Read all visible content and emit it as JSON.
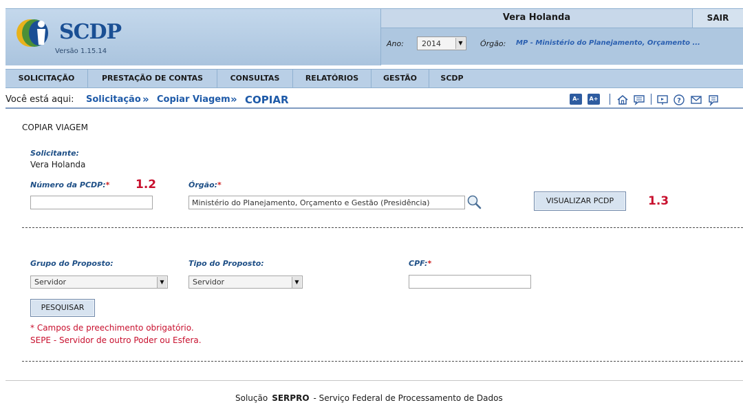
{
  "header": {
    "app_name": "SCDP",
    "version": "Versão 1.15.14",
    "user_name": "Vera Holanda",
    "logout_label": "SAIR",
    "year_label": "Ano:",
    "year_value": "2014",
    "org_label": "Órgão:",
    "org_value": "MP - Ministério do Planejamento, Orçamento ..."
  },
  "menu": {
    "items": [
      {
        "label": "SOLICITAÇÃO"
      },
      {
        "label": "PRESTAÇÃO DE CONTAS"
      },
      {
        "label": "CONSULTAS"
      },
      {
        "label": "RELATÓRIOS"
      },
      {
        "label": "GESTÃO"
      },
      {
        "label": "SCDP"
      }
    ]
  },
  "breadcrumb": {
    "prefix": "Você está aqui:",
    "items": [
      {
        "label": "Solicitação"
      },
      {
        "label": "Copiar Viagem"
      }
    ],
    "current": "COPIAR"
  },
  "toolbar": {
    "font_decrease": "A-",
    "font_increase": "A+",
    "icons": [
      "home-icon",
      "chat-icon",
      "presentation-icon",
      "help-icon",
      "mail-icon",
      "feedback-icon"
    ],
    "accent_color": "#2e5ca0"
  },
  "form": {
    "section_title": "COPIAR VIAGEM",
    "requester_label": "Solicitante:",
    "requester_value": "Vera Holanda",
    "pcdp_label": "Número da PCDP:",
    "pcdp_value": "",
    "org_label": "Órgão:",
    "org_value": "Ministério do Planejamento, Orçamento e Gestão (Presidência)",
    "view_button": "VISUALIZAR PCDP",
    "group_label": "Grupo do Proposto:",
    "group_value": "Servidor",
    "type_label": "Tipo do Proposto:",
    "type_value": "Servidor",
    "cpf_label": "CPF:",
    "cpf_value": "",
    "search_button": "PESQUISAR",
    "required_asterisk": "*",
    "note_required": "* Campos de preechimento obrigatório.",
    "note_sepe": "SEPE - Servidor de outro Poder ou Esfera."
  },
  "annotations": {
    "pcdp_marker": "1.2",
    "view_marker": "1.3"
  },
  "footer": {
    "prefix": "Solução",
    "brand": "SERPRO",
    "suffix": "- Serviço Federal de Processamento de Dados"
  },
  "colors": {
    "header_bg": "#aec7e0",
    "link_blue": "#1e5aa8",
    "required_red": "#c8102e"
  }
}
